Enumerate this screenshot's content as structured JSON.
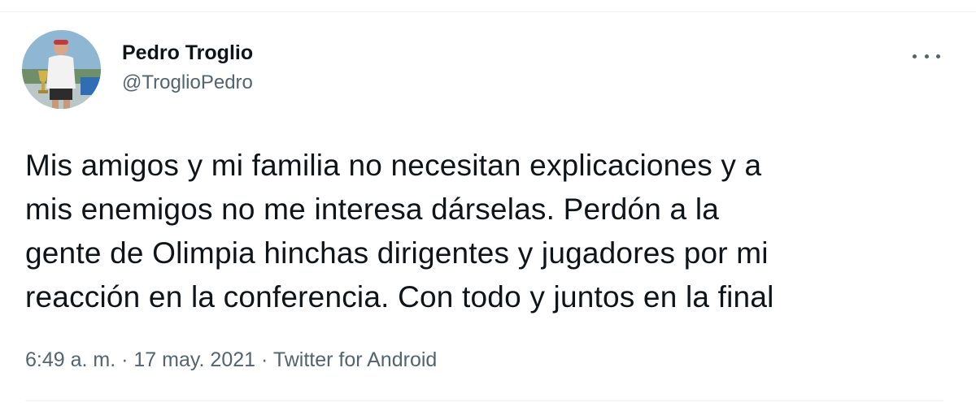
{
  "tweet": {
    "author": {
      "display_name": "Pedro Troglio",
      "handle": "@TroglioPedro",
      "avatar_icon": "avatar-photo"
    },
    "more_icon": "more-options-icon",
    "body_lines": [
      "Mis amigos y mi familia no necesitan explicaciones y a",
      "mis enemigos no me interesa dárselas. Perdón a la",
      "gente de Olimpia hinchas dirigentes y jugadores por mi",
      "reacción en la conferencia. Con todo y juntos en la final"
    ],
    "meta": {
      "time": "6:49 a. m.",
      "separator": "·",
      "date": "17 may. 2021",
      "source": "Twitter for Android"
    }
  },
  "colors": {
    "text_primary": "#0f1419",
    "text_secondary": "#536471",
    "divider": "#eff3f4"
  }
}
